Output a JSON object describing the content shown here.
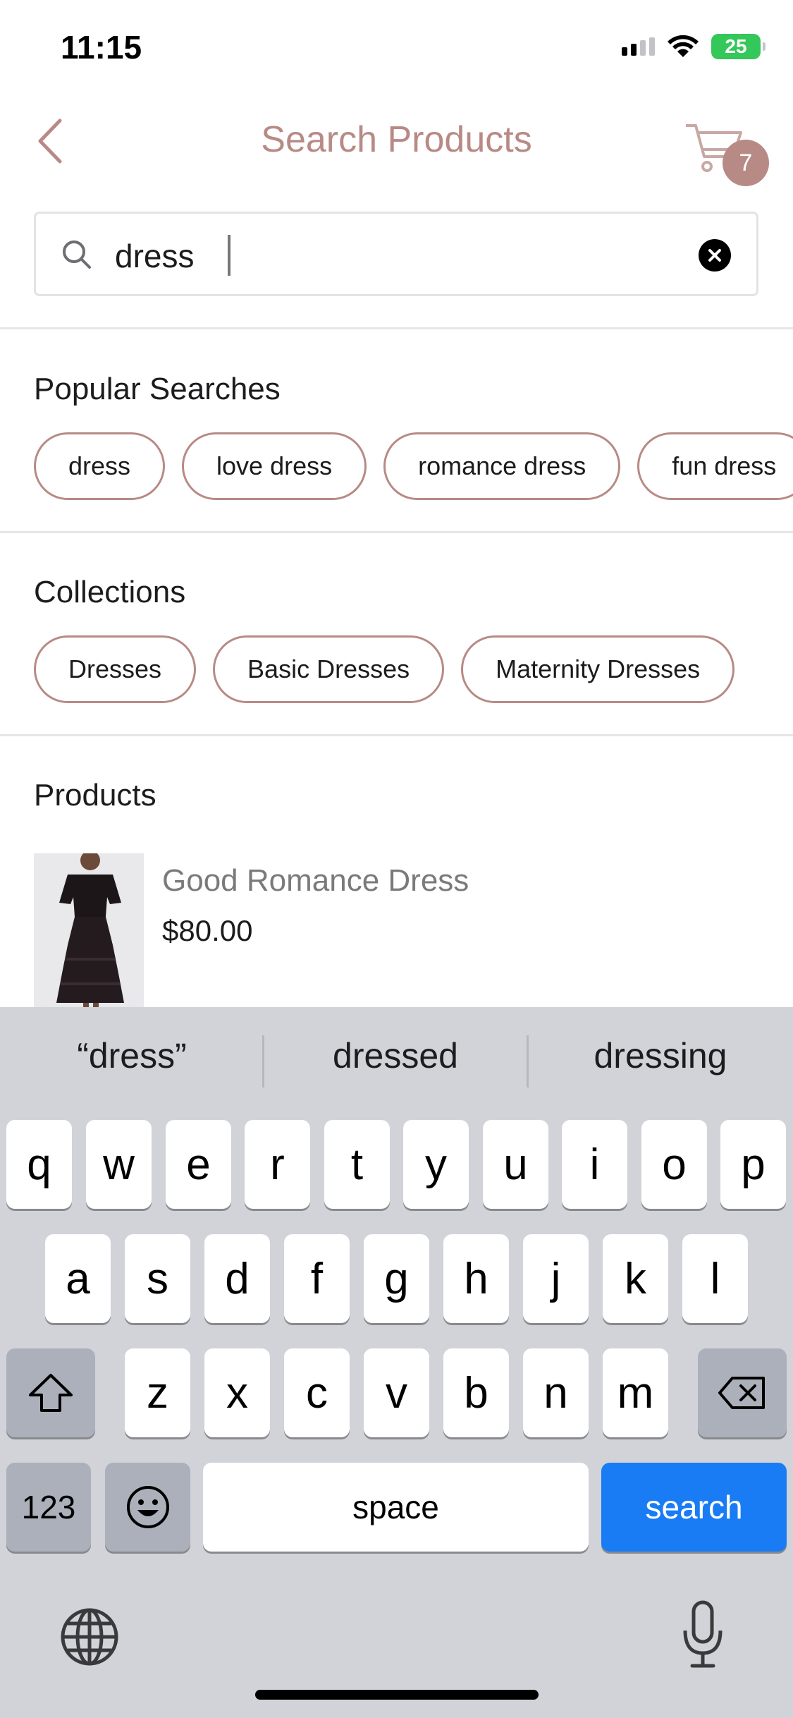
{
  "status_bar": {
    "time": "11:15",
    "battery": "25",
    "icons": [
      "signal-icon",
      "wifi-icon",
      "battery-charging-icon"
    ]
  },
  "header": {
    "title": "Search Products",
    "back_icon": "chevron-left-icon",
    "cart_icon": "cart-icon",
    "cart_count": "7"
  },
  "search": {
    "value": "dress",
    "placeholder": "",
    "search_icon": "search-icon",
    "clear_icon": "clear-icon"
  },
  "popular_searches": {
    "title": "Popular Searches",
    "items": [
      "dress",
      "love dress",
      "romance dress",
      "fun dress"
    ]
  },
  "collections": {
    "title": "Collections",
    "items": [
      "Dresses",
      "Basic Dresses",
      "Maternity Dresses"
    ]
  },
  "products": {
    "title": "Products",
    "items": [
      {
        "name": "Good Romance Dress",
        "price": "$80.00"
      }
    ]
  },
  "keyboard": {
    "suggestions": [
      "“dress”",
      "dressed",
      "dressing"
    ],
    "row1": [
      "q",
      "w",
      "e",
      "r",
      "t",
      "y",
      "u",
      "i",
      "o",
      "p"
    ],
    "row2": [
      "a",
      "s",
      "d",
      "f",
      "g",
      "h",
      "j",
      "k",
      "l"
    ],
    "row3": [
      "z",
      "x",
      "c",
      "v",
      "b",
      "n",
      "m"
    ],
    "numbers_label": "123",
    "space_label": "space",
    "action_label": "search"
  },
  "colors": {
    "accent": "#b88a85",
    "keyboard_bg": "#d1d3d9",
    "search_key": "#1a7cf5"
  }
}
